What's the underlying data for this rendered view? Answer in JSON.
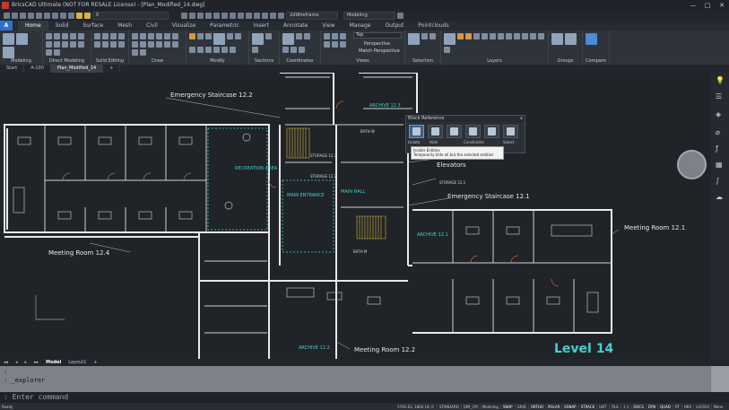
{
  "window": {
    "title": "BricsCAD Ultimate (NOT FOR RESALE License) - [Plan_Modified_14.dwg]",
    "min": "—",
    "max": "□",
    "close": "✕"
  },
  "quick_access": {
    "layer_value": "0",
    "visual_style": "2dWireframe",
    "workspace": "Modeling"
  },
  "ribbon_tabs": [
    "Home",
    "Solid",
    "Surface",
    "Mesh",
    "Civil",
    "Visualize",
    "Parametric",
    "Insert",
    "Annotate",
    "View",
    "Manage",
    "Output",
    "Pointclouds"
  ],
  "active_tab": "Home",
  "ribbon_groups": [
    {
      "label": "Modeling"
    },
    {
      "label": "Direct Modeling"
    },
    {
      "label": "Solid Editing"
    },
    {
      "label": "Draw"
    },
    {
      "label": "Modify"
    },
    {
      "label": "Sections"
    },
    {
      "label": "Coordinates"
    },
    {
      "label": "Views"
    },
    {
      "label": "Selection"
    },
    {
      "label": "Layers"
    },
    {
      "label": "Groups"
    },
    {
      "label": "Compare"
    }
  ],
  "ribbon_items": {
    "perspective": "Perspective",
    "match_perspective": "Match Perspective",
    "top_view": "Top"
  },
  "doc_tabs": [
    "Start",
    "A-100",
    "Plan_Modified_14"
  ],
  "active_doc": "Plan_Modified_14",
  "drawing_labels": {
    "emergency_122": "Emergency Staircase 12.2",
    "emergency_121": "Emergency Staircase 12.1",
    "archive_123": "ARCHIVE 12.3",
    "archive_122": "ARCHIVE 12.2",
    "archive_121": "ARCHIVE 12.1",
    "elevators": "Elevators",
    "meeting_124": "Meeting Room 12.4",
    "meeting_121": "Meeting Room 12.1",
    "meeting_122": "Meeting Room 12.2",
    "recreation": "RECREATION AREA",
    "main_entrance": "MAIN ENTRANCE",
    "main_hall": "MAIN HALL",
    "storage_123": "STORAGE 12.3",
    "storage_122": "STORAGE 12.2",
    "storage_121": "STORAGE 12.1",
    "bath_w": "BATH W",
    "bath_m": "BATH M",
    "level": "Level 14"
  },
  "block_reference": {
    "title": "Block Reference",
    "close": "x",
    "btn_labels": [
      "Isolate",
      "Hide",
      "Constraints",
      "Select"
    ],
    "tooltip_title": "Isolate Entities",
    "tooltip_text": "Temporarily hide all but the selected entities"
  },
  "layout_tabs": [
    "Model",
    "Layout1"
  ],
  "active_layout": "Model",
  "command": {
    "history": [
      ":",
      ": _explorer"
    ],
    "prompt": ": Enter command"
  },
  "status": {
    "ready": "Ready",
    "coords": "5792.63, 1802.18, 0",
    "buttons": [
      "STANDARD",
      "DIM_CM",
      "Modeling",
      "SNAP",
      "GRID",
      "ORTHO",
      "POLAR",
      "ESNAP",
      "STRACK",
      "LWT",
      "TILE",
      "1:1",
      "DUCS",
      "DYN",
      "QUAD",
      "RT",
      "HKA",
      "LOCKUI",
      "None"
    ]
  },
  "colors": {
    "accent": "#2f6fd0",
    "cyan_label": "#3fd3d0",
    "wall": "#e8e8e8",
    "door": "#c46a3c",
    "hatch": "#d8b640"
  }
}
